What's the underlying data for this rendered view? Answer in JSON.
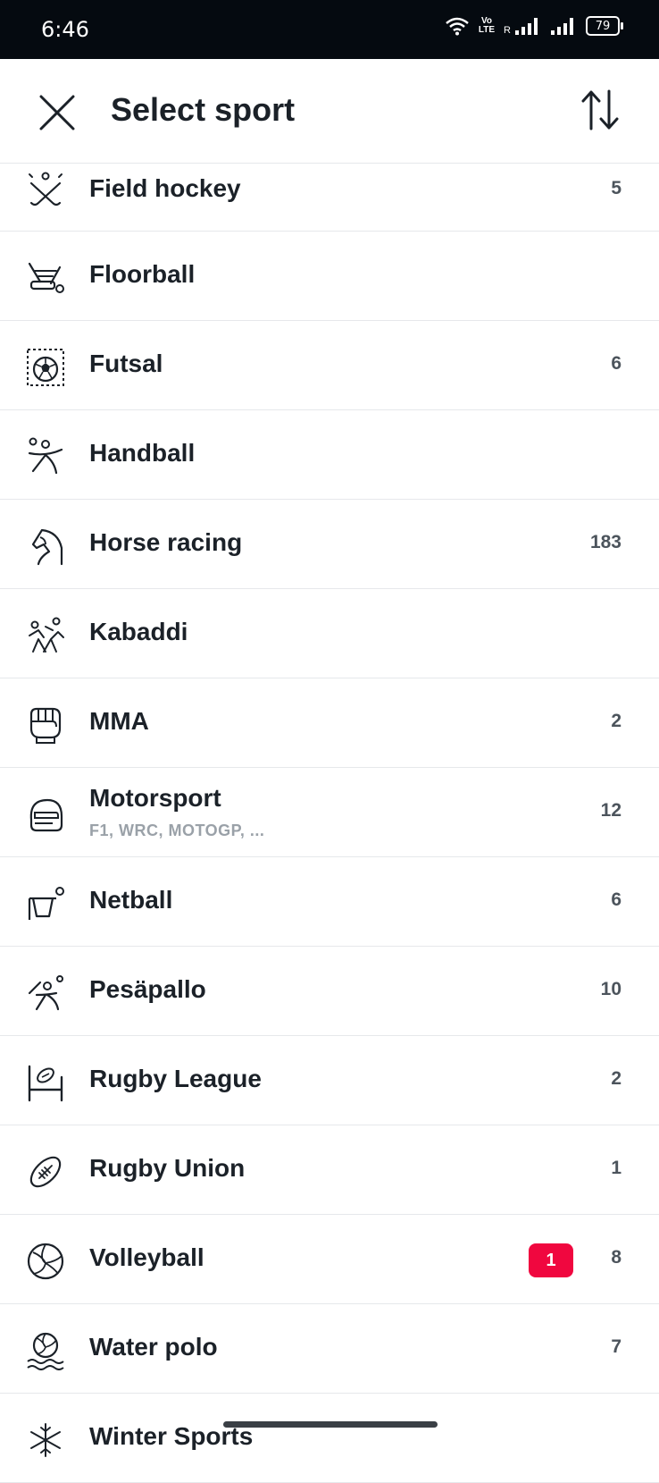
{
  "status_bar": {
    "time": "6:46",
    "volte": "Vo LTE",
    "roaming": "R",
    "battery": "79"
  },
  "header": {
    "title": "Select sport"
  },
  "sports": [
    {
      "name": "Field hockey",
      "count": "5",
      "icon": "field-hockey-icon"
    },
    {
      "name": "Floorball",
      "count": "",
      "icon": "floorball-icon"
    },
    {
      "name": "Futsal",
      "count": "6",
      "icon": "futsal-icon"
    },
    {
      "name": "Handball",
      "count": "",
      "icon": "handball-icon"
    },
    {
      "name": "Horse racing",
      "count": "183",
      "icon": "horse-racing-icon"
    },
    {
      "name": "Kabaddi",
      "count": "",
      "icon": "kabaddi-icon"
    },
    {
      "name": "MMA",
      "count": "2",
      "icon": "mma-icon"
    },
    {
      "name": "Motorsport",
      "subtitle": "F1, WRC, MOTOGP, ...",
      "count": "12",
      "icon": "motorsport-icon"
    },
    {
      "name": "Netball",
      "count": "6",
      "icon": "netball-icon"
    },
    {
      "name": "Pesäpallo",
      "count": "10",
      "icon": "pesapallo-icon"
    },
    {
      "name": "Rugby League",
      "count": "2",
      "icon": "rugby-league-icon"
    },
    {
      "name": "Rugby Union",
      "count": "1",
      "icon": "rugby-union-icon"
    },
    {
      "name": "Volleyball",
      "count": "8",
      "live": "1",
      "icon": "volleyball-icon"
    },
    {
      "name": "Water polo",
      "count": "7",
      "icon": "water-polo-icon"
    },
    {
      "name": "Winter Sports",
      "count": "",
      "icon": "winter-sports-icon"
    }
  ],
  "colors": {
    "live_badge": "#f0073f",
    "status_bar": "#050a10"
  }
}
